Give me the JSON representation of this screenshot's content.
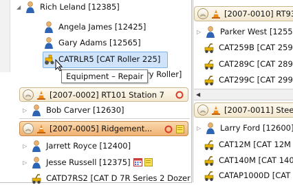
{
  "left_tree": {
    "items": [
      {
        "label": "Rich Leland [12385]",
        "icon": "person-icon",
        "expander": "▲"
      },
      {
        "label": "Angela James [12425]",
        "icon": "person-icon"
      },
      {
        "label": "Gary Adams [12565]",
        "icon": "person-icon"
      },
      {
        "label": "CATRLR5 [CAT Roller 225]",
        "icon": "roller-equipment-icon"
      },
      {
        "label": "ory Roller]",
        "icon": ""
      }
    ],
    "tooltip": "Equipment – Repair"
  },
  "left_groups": [
    {
      "header": "[2007-0002] RT101 Station 7",
      "style": "cream",
      "status_icon": "circle-status-icon",
      "rows": [
        {
          "label": "Bob Carver [12630]",
          "icon": "person-icon",
          "expander": "▷"
        }
      ]
    },
    {
      "header": "[2007-0005] Ridgement...",
      "style": "orange",
      "status_icon": "circle-status-icon",
      "rows": [
        {
          "label": "Jarrett Royce [12400]",
          "icon": "person-icon",
          "expander": "▷"
        },
        {
          "label": "Jesse Russell [12375]",
          "icon": "person-icon",
          "expander": "▷"
        },
        {
          "label": "CATD7RS2 [CAT D 7R Series 2 Dozer",
          "icon": "equipment-icon"
        }
      ]
    }
  ],
  "right_groups": [
    {
      "header": "[2007-0010] RT93",
      "style": "cream",
      "rows": [
        {
          "label": "Parker West [1255",
          "icon": "person-icon",
          "expander": "▷"
        },
        {
          "label": "CAT259B [CAT 259",
          "icon": "equipment-icon"
        },
        {
          "label": "CAT289C [CAT 289",
          "icon": "equipment-icon"
        },
        {
          "label": "CAT299C [CAT 299",
          "icon": "equipment-icon"
        }
      ]
    },
    {
      "header": "[2007-0011] Stee",
      "style": "cream",
      "rows": [
        {
          "label": "Larry Ford [12600]",
          "icon": "person-icon",
          "expander": "▷"
        },
        {
          "label": "CAT12M [CAT 12M",
          "icon": "equipment-icon"
        },
        {
          "label": "CAT140M [CAT 140",
          "icon": "equipment-icon"
        },
        {
          "label": "CATAP1000D [CAT",
          "icon": "equipment-icon"
        }
      ]
    }
  ],
  "scrollbar": {
    "left_arrow": "◀"
  },
  "colors": {
    "accent_orange": "#f0b173",
    "status_red": "#d63b2a",
    "selection_blue": "#cfe4fb"
  }
}
